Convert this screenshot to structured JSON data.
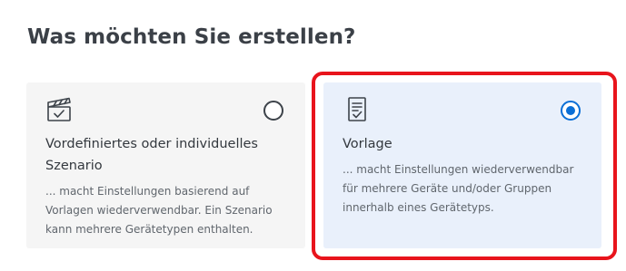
{
  "page": {
    "title": "Was möchten Sie erstellen?"
  },
  "options": [
    {
      "title": "Vordefiniertes oder individuelles Szenario",
      "description": "... macht Einstellungen basierend auf Vorlagen wiederverwendbar. Ein Szenario kann mehrere Gerätetypen enthalten.",
      "icon": "clapperboard-check-icon",
      "selected": false
    },
    {
      "title": "Vorlage",
      "description": "... macht Einstellungen wiederverwendbar für mehrere Geräte und/oder Gruppen innerhalb eines Gerätetyps.",
      "icon": "document-check-icon",
      "selected": true
    }
  ],
  "colors": {
    "accent": "#0a6fd6",
    "highlight_frame": "#e8141c",
    "selected_card_bg": "#e9f0fb",
    "card_bg": "#f5f5f5"
  }
}
